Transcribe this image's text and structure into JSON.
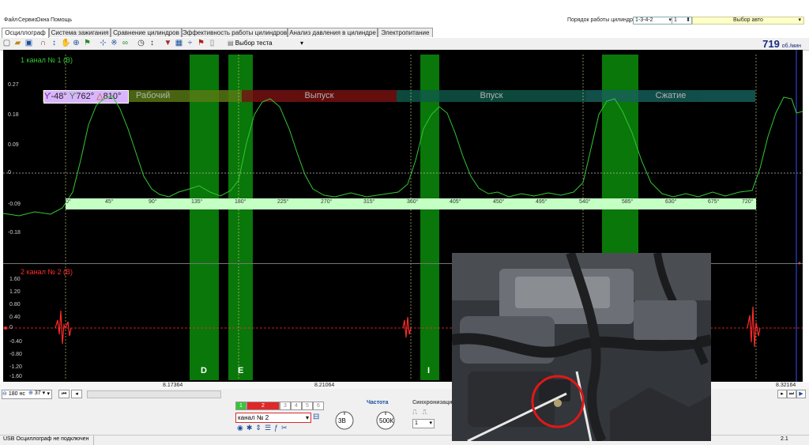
{
  "menu": {
    "file": "Файл",
    "service": "Сервис",
    "windows": "Окна",
    "help": "Помощь"
  },
  "top_right": {
    "firing_order_label": "Порядок работы цилиндров:",
    "firing_order_value": "1-3-4-2",
    "cylinder_value": "1",
    "select_car": "Выбор авто"
  },
  "tabs": [
    {
      "label": "Осциллограф"
    },
    {
      "label": "Система зажигания"
    },
    {
      "label": "Сравнение цилиндров"
    },
    {
      "label": "Эффективность работы цилиндров"
    },
    {
      "label": "Анализ давления в цилиндре"
    },
    {
      "label": "Электропитание"
    }
  ],
  "toolbar": {
    "test_select": "Выбор теста",
    "rpm_value": "719",
    "rpm_unit": "об./мин"
  },
  "channel1": {
    "title": "1  канал № 1 (В)",
    "y_ticks": [
      "0.27",
      "0.18",
      "0.09",
      "0",
      "-0.09",
      "-0.18"
    ],
    "measure_a": "-48°",
    "measure_b": "762°",
    "measure_delta": "810°"
  },
  "channel2": {
    "title": "2  канал № 2 (В)",
    "y_ticks": [
      "1.60",
      "1.20",
      "0.80",
      "0.40",
      "0",
      "-0.40",
      "-0.80",
      "-1.20",
      "-1.60"
    ]
  },
  "phases": [
    "Рабочий",
    "Выпуск",
    "Впуск",
    "Сжатие"
  ],
  "degree_scale": [
    "0°",
    "45°",
    "90°",
    "135°",
    "180°",
    "225°",
    "270°",
    "315°",
    "360°",
    "405°",
    "450°",
    "495°",
    "540°",
    "585°",
    "630°",
    "675°",
    "720°"
  ],
  "band_letters": [
    "D",
    "E",
    "I"
  ],
  "time_labels": [
    "8.17364",
    "8.21064",
    "8.32164"
  ],
  "bottom": {
    "time_per_div": "180 нс",
    "sample_value": "37",
    "channel_tabs": [
      "1",
      "2",
      "3",
      "4",
      "5",
      "6"
    ],
    "channel_select": "канал № 2",
    "voltage_knob": "3В",
    "freq_title": "Частота",
    "freq_knob": "500К",
    "sync_title": "Синхронизация",
    "sync_value": "1"
  },
  "status": {
    "usb": "USB Осциллограф не подключен",
    "version": "2.1"
  },
  "colors": {
    "scope_bg": "#000000",
    "ch1_trace": "#32c832",
    "ch2_trace": "#ff2a2a",
    "band_green": "#0a8c0a",
    "phase_work": "#5a7a14",
    "phase_exhaust": "#7a1212",
    "phase_intake": "#0f5a4a",
    "phase_compression": "#16605a"
  }
}
